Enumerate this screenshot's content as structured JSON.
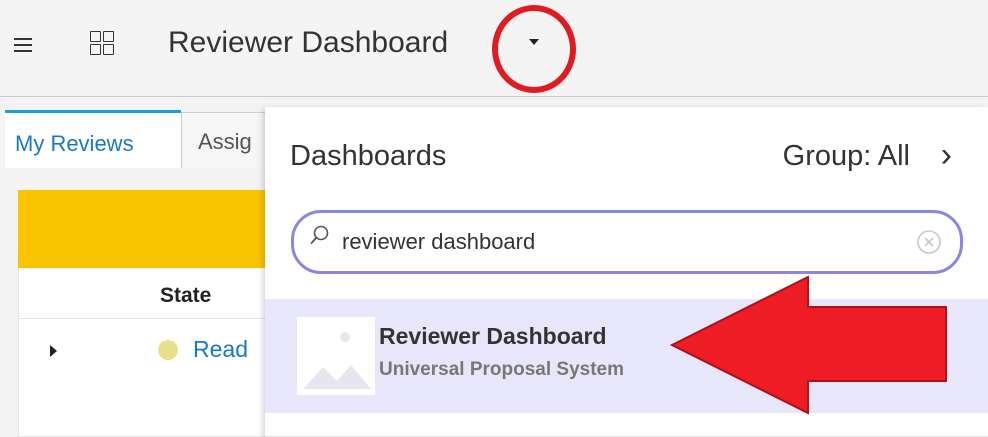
{
  "header": {
    "title": "Reviewer Dashboard",
    "menu_icon": "hamburger-icon",
    "apps_icon": "grid-icon",
    "dropdown_icon": "caret-down-icon"
  },
  "page": {
    "tabs": [
      {
        "label": "My Reviews",
        "active": true
      },
      {
        "label": "Assig",
        "active": false
      }
    ],
    "table": {
      "column": "State",
      "row_state": "Read"
    }
  },
  "dropdown": {
    "title": "Dashboards",
    "group_label": "Group: All",
    "search": {
      "value": "reviewer dashboard"
    },
    "result": {
      "name": "Reviewer Dashboard",
      "subtitle": "Universal Proposal System"
    }
  },
  "colors": {
    "accent_blue": "#1a78c2",
    "tab_border": "#1a9fd8",
    "banner_yellow": "#f9c500",
    "search_border": "#8b85e6",
    "result_highlight": "#e8e6fa",
    "annotation_red": "#e01b22"
  }
}
